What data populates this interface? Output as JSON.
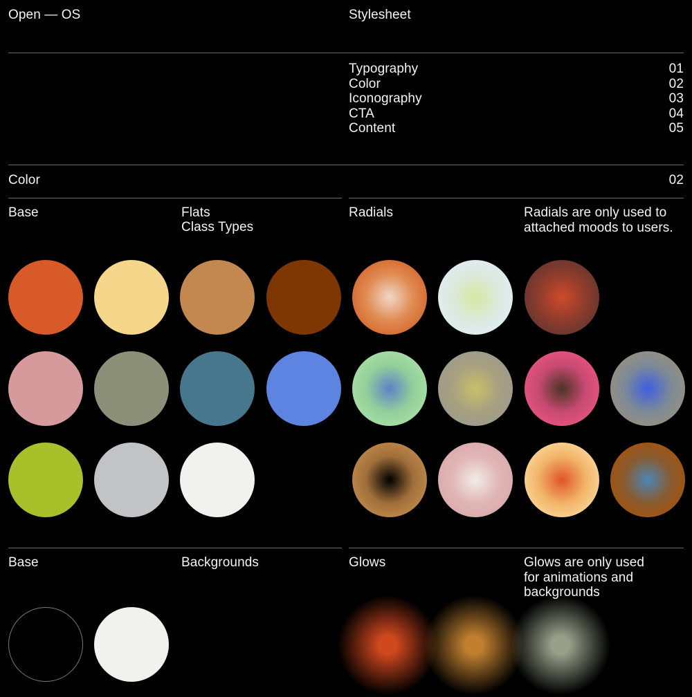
{
  "header": {
    "brand": "Open — OS",
    "section_title": "Stylesheet"
  },
  "toc": {
    "items": [
      {
        "label": "Typography",
        "number": "01"
      },
      {
        "label": "Color",
        "number": "02"
      },
      {
        "label": "Iconography",
        "number": "03"
      },
      {
        "label": "CTA",
        "number": "04"
      },
      {
        "label": "Content",
        "number": "05"
      }
    ]
  },
  "section": {
    "title": "Color",
    "number": "02"
  },
  "columns": {
    "left": {
      "label": "Base",
      "sublabel_line1": "Flats",
      "sublabel_line2": "Class Types"
    },
    "right": {
      "label": "Radials",
      "description": "Radials are only used to attached moods to users."
    }
  },
  "bottom": {
    "left": {
      "label": "Base",
      "sublabel": "Backgrounds"
    },
    "right": {
      "label": "Glows",
      "description": "Glows are only used for animations and backgrounds"
    }
  },
  "palette": {
    "flats": [
      {
        "name": "burnt-orange",
        "hex": "#d75a28"
      },
      {
        "name": "pale-gold",
        "hex": "#f6d68a"
      },
      {
        "name": "camel-tan",
        "hex": "#c2884f"
      },
      {
        "name": "dark-brown",
        "hex": "#7e3703"
      },
      {
        "name": "dusty-rose",
        "hex": "#d79a9c"
      },
      {
        "name": "sage-olive",
        "hex": "#8d9079"
      },
      {
        "name": "teal-blue",
        "hex": "#47778c"
      },
      {
        "name": "periwinkle-blue",
        "hex": "#5c84e0"
      },
      {
        "name": "lime-green",
        "hex": "#a8c029"
      },
      {
        "name": "light-gray",
        "hex": "#c2c3c5"
      },
      {
        "name": "off-white",
        "hex": "#f1f1ed"
      }
    ],
    "radials": [
      {
        "name": "orange-light-core",
        "center": "#f0d8c8",
        "mid": "#e08b52",
        "edge": "#d4672c"
      },
      {
        "name": "ice-blue-lime-core",
        "center": "#d6e8a0",
        "mid": "#dce9de",
        "edge": "#e2ecf4"
      },
      {
        "name": "brown-ember-core",
        "center": "#cf4a2c",
        "mid": "#8e3c2c",
        "edge": "#63362f"
      },
      {
        "name": "green-blue-core",
        "center": "#5f82c8",
        "mid": "#93cf9a",
        "edge": "#a9e0a6"
      },
      {
        "name": "olive-yellow-core",
        "center": "#c8c06a",
        "mid": "#a8a080",
        "edge": "#9b9a8c"
      },
      {
        "name": "pink-dark-core",
        "center": "#4a3526",
        "mid": "#c84a72",
        "edge": "#e8557f"
      },
      {
        "name": "gray-blue-core",
        "center": "#3f5fe0",
        "mid": "#7e8a96",
        "edge": "#97917f"
      },
      {
        "name": "tan-black-core",
        "center": "#000000",
        "mid": "#a06f3a",
        "edge": "#c08a4c"
      },
      {
        "name": "pink-white-core",
        "center": "#f2ece8",
        "mid": "#e0b6b6",
        "edge": "#dba9ab"
      },
      {
        "name": "gold-red-core",
        "center": "#e0542a",
        "mid": "#f2b468",
        "edge": "#fad79a"
      },
      {
        "name": "brown-blue-core",
        "center": "#4b86b4",
        "mid": "#8a5a2e",
        "edge": "#a4540d"
      }
    ],
    "backgrounds": [
      {
        "name": "black-outline",
        "hex": "#000000",
        "stroke": "#7a7a7a"
      },
      {
        "name": "off-white-fill",
        "hex": "#f1f1ed"
      }
    ],
    "glows": [
      {
        "name": "ember-glow",
        "hex": "#d0481e"
      },
      {
        "name": "amber-glow",
        "hex": "#c08030"
      },
      {
        "name": "sage-glow",
        "hex": "#98a08a"
      }
    ]
  }
}
